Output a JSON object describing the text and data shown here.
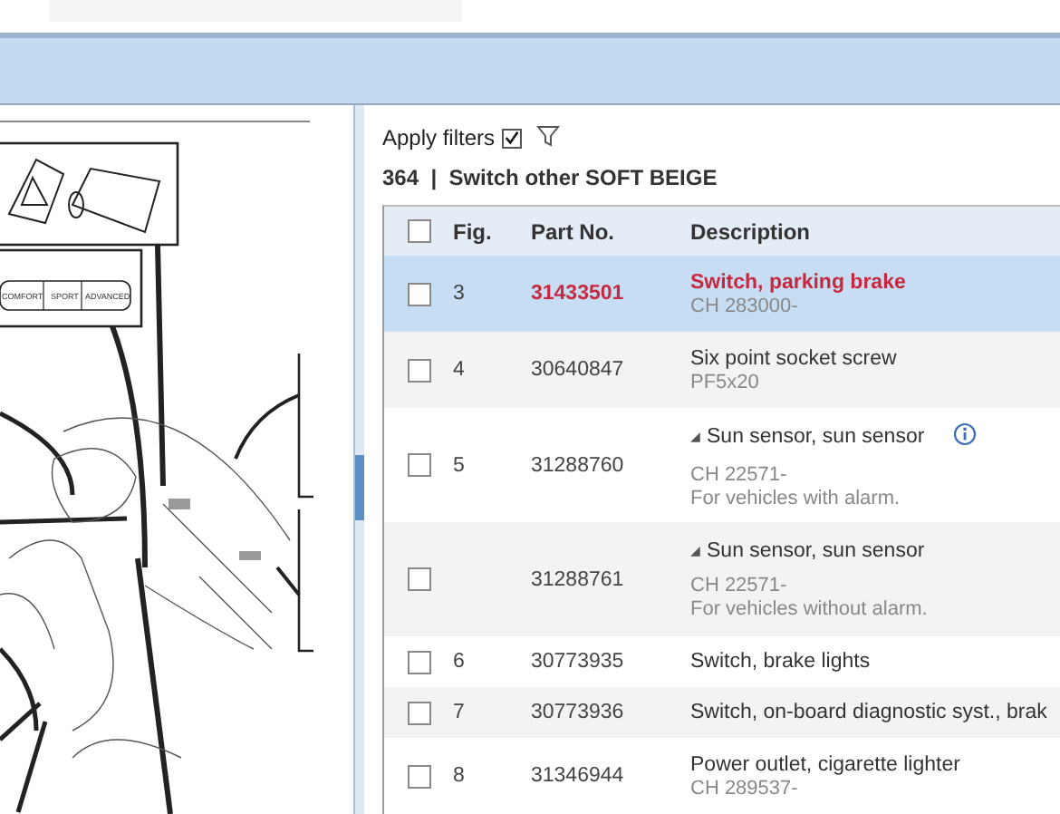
{
  "filters": {
    "label": "Apply filters",
    "checked": true
  },
  "group_title": "364  |  Switch other SOFT BEIGE",
  "diagram": {
    "labels": [
      "COMFORT",
      "SPORT",
      "ADVANCED"
    ]
  },
  "table": {
    "header_checked": false,
    "columns": [
      "Fig.",
      "Part No.",
      "Description"
    ],
    "rows": [
      {
        "fig": "3",
        "part": "31433501",
        "title": "Switch, parking brake",
        "notes": [
          "CH 283000-"
        ],
        "selected": true,
        "checked": false,
        "expander": "",
        "info": false
      },
      {
        "fig": "4",
        "part": "30640847",
        "title": "Six point socket screw",
        "notes": [
          "PF5x20"
        ],
        "selected": false,
        "checked": false,
        "expander": "",
        "info": false
      },
      {
        "fig": "5",
        "part": "31288760",
        "title": "Sun sensor, sun sensor",
        "notes": [
          "CH 22571-",
          "For vehicles with alarm."
        ],
        "selected": false,
        "checked": false,
        "expander": "◢",
        "info": true
      },
      {
        "fig": "",
        "part": "31288761",
        "title": "Sun sensor, sun sensor",
        "notes": [
          "CH 22571-",
          "For vehicles without alarm."
        ],
        "selected": false,
        "checked": false,
        "expander": "◢",
        "info": false
      },
      {
        "fig": "6",
        "part": "30773935",
        "title": "Switch, brake lights",
        "notes": [],
        "selected": false,
        "checked": false,
        "expander": "",
        "info": false
      },
      {
        "fig": "7",
        "part": "30773936",
        "title": "Switch, on-board diagnostic syst., brak",
        "notes": [],
        "selected": false,
        "checked": false,
        "expander": "",
        "info": false
      },
      {
        "fig": "8",
        "part": "31346944",
        "title": "Power outlet, cigarette lighter",
        "notes": [
          "CH 289537-"
        ],
        "selected": false,
        "checked": false,
        "expander": "",
        "info": false
      }
    ]
  }
}
